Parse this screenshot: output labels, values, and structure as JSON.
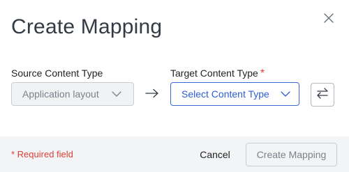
{
  "dialog": {
    "title": "Create Mapping",
    "close_icon": "close-icon"
  },
  "source": {
    "label": "Source Content Type",
    "selected_value": "Application layout",
    "disabled": true,
    "chevron_icon": "chevron-down-icon"
  },
  "arrow_icon": "arrow-right-icon",
  "target": {
    "label": "Target Content Type",
    "required_marker": "*",
    "placeholder": "Select Content Type",
    "chevron_icon": "chevron-down-icon"
  },
  "swap_button": {
    "icon": "swap-arrows-icon"
  },
  "footer": {
    "required_note": "* Required field",
    "cancel_label": "Cancel",
    "create_label": "Create Mapping",
    "create_disabled": true
  },
  "colors": {
    "accent": "#2d5dd6",
    "error": "#dd3f35",
    "footer_bg": "#f3f4f6",
    "disabled_text": "#7b818b"
  }
}
